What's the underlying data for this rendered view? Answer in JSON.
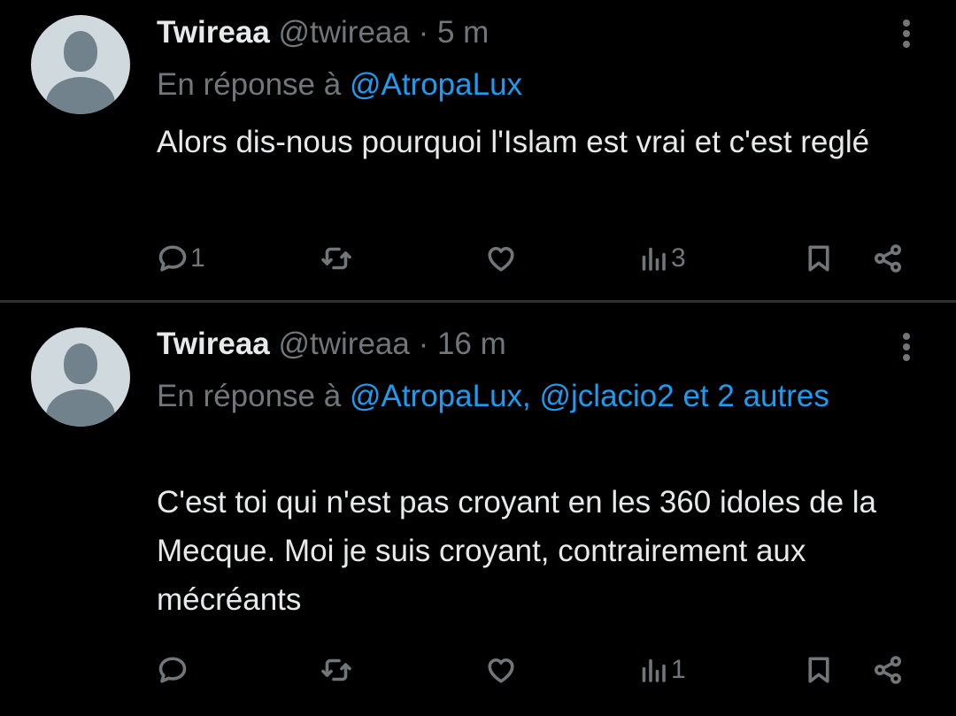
{
  "tweets": [
    {
      "display_name": "Twireaa",
      "handle": "@twireaa",
      "separator": "·",
      "time": "5 m",
      "reply_prefix": "En réponse à",
      "reply_mentions": "@AtropaLux",
      "reply_tail": "",
      "text": "Alors dis-nous pourquoi l'Islam est vrai et c'est reglé",
      "reply_count": "1",
      "retweet_count": "",
      "like_count": "",
      "view_count": "3"
    },
    {
      "display_name": "Twireaa",
      "handle": "@twireaa",
      "separator": "·",
      "time": "16 m",
      "reply_prefix": "En réponse à",
      "reply_mentions": "@AtropaLux, @jclacio2 et 2 autres",
      "reply_tail": "",
      "text": "C'est toi qui n'est pas croyant en les 360 idoles de la Mecque. Moi je suis croyant, contrairement aux mécréants",
      "reply_count": "",
      "retweet_count": "",
      "like_count": "",
      "view_count": "1"
    }
  ],
  "icons": [
    "more-icon",
    "reply-icon",
    "retweet-icon",
    "like-icon",
    "views-icon",
    "bookmark-icon",
    "share-icon"
  ],
  "colors": {
    "background": "#000000",
    "text": "#e7e9ea",
    "muted": "#71767b",
    "link": "#1d9bf0"
  }
}
